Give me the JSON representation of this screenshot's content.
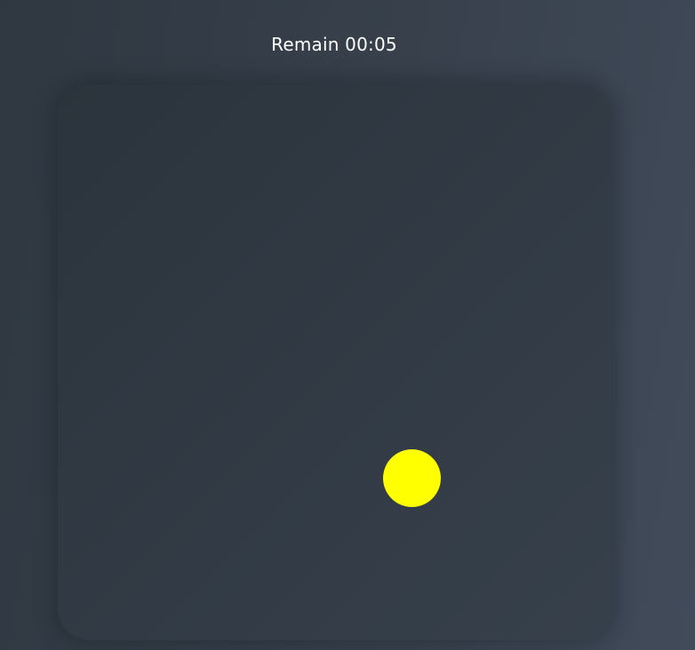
{
  "hud": {
    "timer_text": "Remain 00:05"
  },
  "colors": {
    "target": "#ffff00",
    "board": "#2f3842",
    "text": "#ffffff"
  },
  "board": {
    "target": {
      "shape": "circle"
    }
  }
}
